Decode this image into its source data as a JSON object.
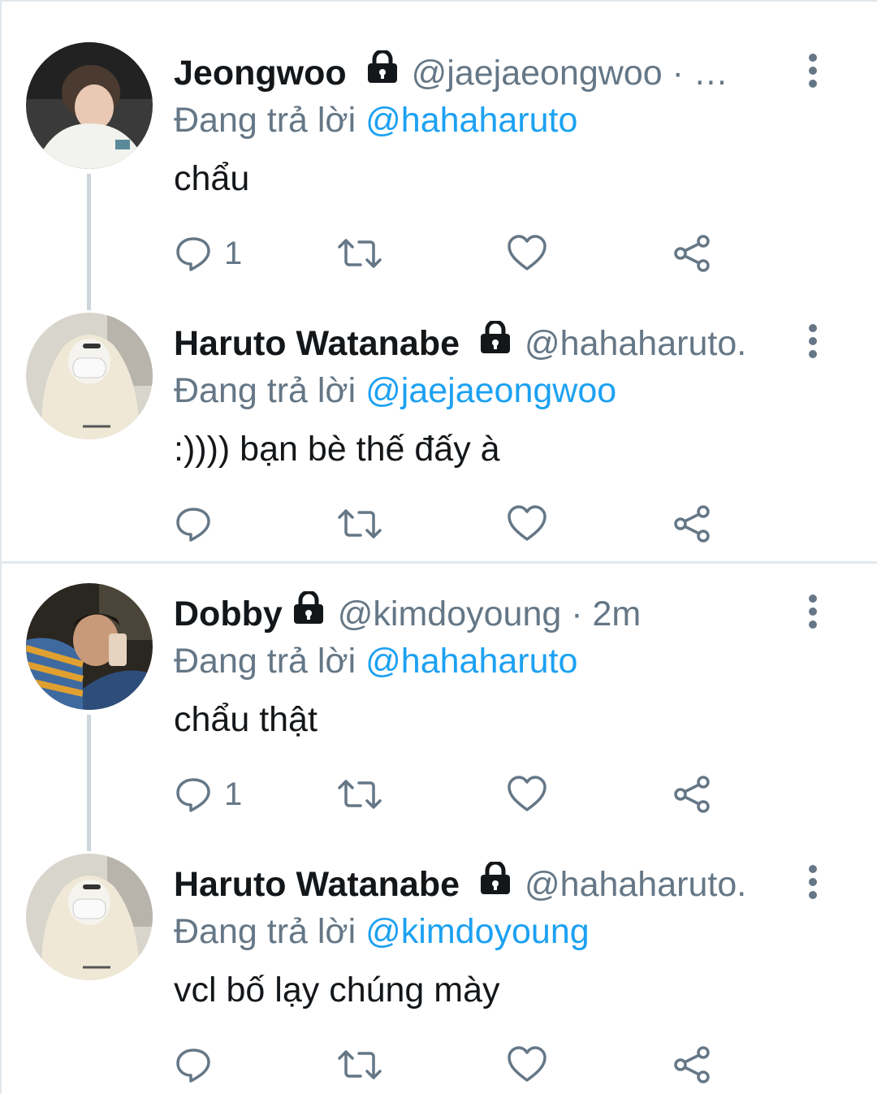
{
  "reply_prefix": "Đang trả lời",
  "tweets": [
    {
      "name": "Jeongwoo",
      "handle": "@jaejaeongwoo · …",
      "reply_to": "@hahaharuto",
      "text": "chẩu",
      "reply_count": "1"
    },
    {
      "name": "Haruto Watanabe",
      "handle": "@hahaharuto.",
      "reply_to": "@jaejaeongwoo",
      "text": ":)))) bạn bè thế đấy à",
      "reply_count": ""
    },
    {
      "name": "Dobby",
      "handle": "@kimdoyoung · 2m",
      "reply_to": "@hahaharuto",
      "text": "chẩu thật",
      "reply_count": "1"
    },
    {
      "name": "Haruto Watanabe",
      "handle": "@hahaharuto.",
      "reply_to": "@kimdoyoung",
      "text": "vcl bố lạy chúng mày",
      "reply_count": ""
    }
  ],
  "colors": {
    "link": "#1da1f2",
    "secondary_text": "#657786",
    "thread_line": "#ccd6dd",
    "divider": "#e1e8ed"
  },
  "icons": [
    "lock-icon",
    "more-icon",
    "reply-icon",
    "retweet-icon",
    "like-icon",
    "share-icon"
  ]
}
